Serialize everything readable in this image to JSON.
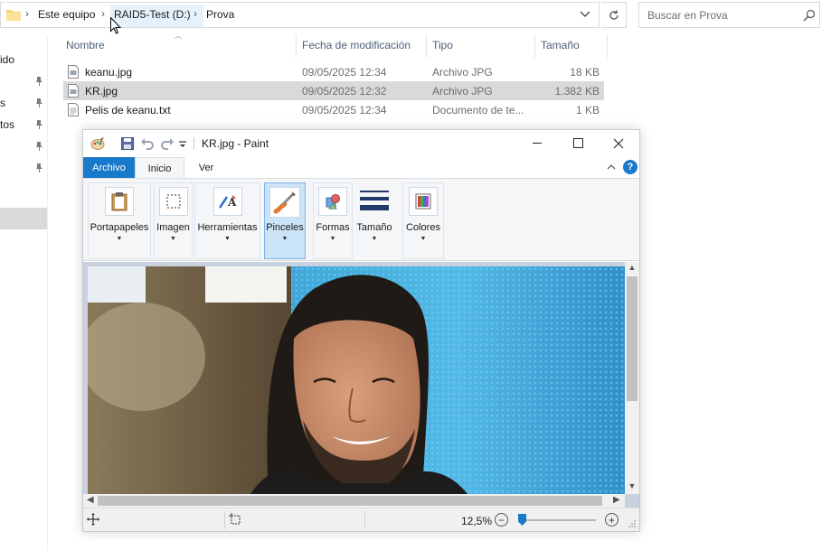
{
  "explorer": {
    "breadcrumb": [
      "Este equipo",
      "RAID5-Test (D:)",
      "Prova"
    ],
    "search_placeholder": "Buscar en Prova",
    "left_pane": [
      {
        "label": "ido",
        "pinned": false
      },
      {
        "label": "s",
        "pinned": true
      },
      {
        "label": "tos",
        "pinned": true
      }
    ],
    "columns": [
      "Nombre",
      "Fecha de modificación",
      "Tipo",
      "Tamaño"
    ],
    "files": [
      {
        "name": "keanu.jpg",
        "date": "09/05/2025 12:34",
        "type": "Archivo JPG",
        "size": "18 KB",
        "icon": "image-file-icon"
      },
      {
        "name": "KR.jpg",
        "date": "09/05/2025 12:32",
        "type": "Archivo JPG",
        "size": "1.382 KB",
        "icon": "image-file-icon",
        "selected": true
      },
      {
        "name": "Pelis de keanu.txt",
        "date": "09/05/2025 12:34",
        "type": "Documento de te...",
        "size": "1 KB",
        "icon": "text-file-icon"
      }
    ]
  },
  "paint": {
    "title": "KR.jpg - Paint",
    "tabs": [
      "Archivo",
      "Inicio",
      "Ver"
    ],
    "help_label": "?",
    "groups": [
      {
        "label": "Portapapeles",
        "icon": "clipboard-icon"
      },
      {
        "label": "Imagen",
        "icon": "select-icon"
      },
      {
        "label": "Herramientas",
        "icon": "tools-icon"
      },
      {
        "label": "Pinceles",
        "icon": "brush-icon",
        "active": true
      },
      {
        "label": "Formas",
        "icon": "shapes-icon"
      },
      {
        "label": "Tamaño",
        "icon": "size-icon"
      },
      {
        "label": "Colores",
        "icon": "colors-icon"
      }
    ],
    "zoom": "12,5%",
    "colors": {
      "accent": "#1979ca",
      "canvas_bg": "#c8d1e0"
    }
  }
}
